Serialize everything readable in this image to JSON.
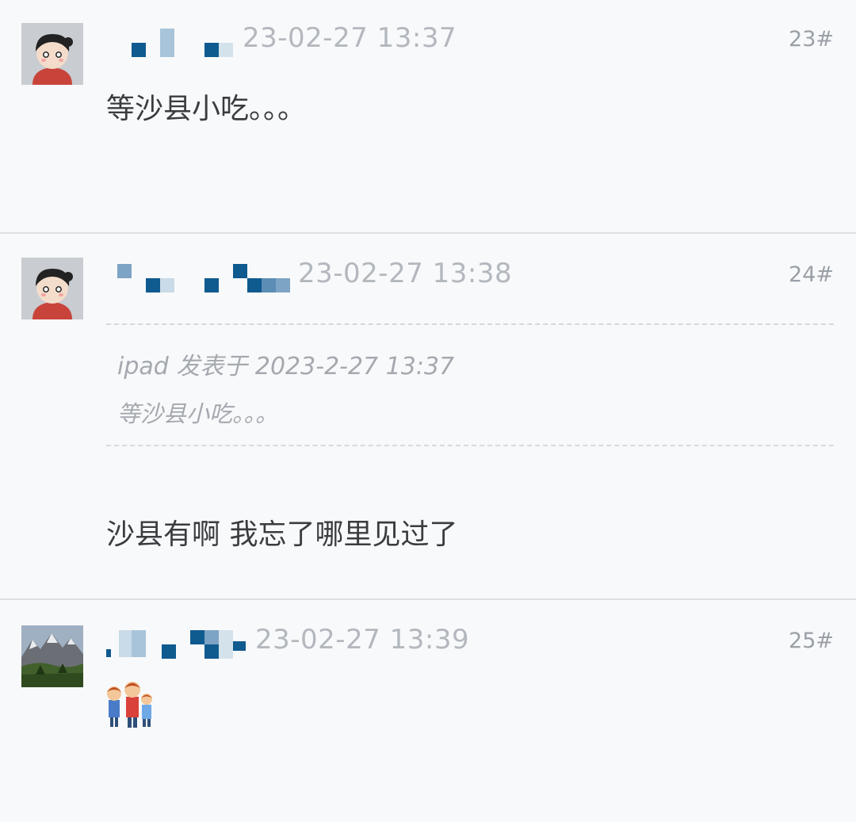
{
  "posts": [
    {
      "avatar": "girl-avatar-icon",
      "timestamp": "23-02-27 13:37",
      "floor": "23#",
      "content": "等沙县小吃。。。"
    },
    {
      "avatar": "girl-avatar-icon",
      "timestamp": "23-02-27 13:38",
      "floor": "24#",
      "quote": {
        "meta": "ipad 发表于 2023-2-27 13:37",
        "text": "等沙县小吃。。。"
      },
      "content": "沙县有啊 我忘了哪里见过了"
    },
    {
      "avatar": "mountain-landscape-avatar-icon",
      "timestamp": "23-02-27 13:39",
      "floor": "25#",
      "content_icon": "group-of-people-emoji-icon"
    }
  ],
  "colors": {
    "background": "#f8f9fa",
    "timestamp": "#b3b8be",
    "content": "#3a3c40",
    "quote": "#a4a9af",
    "pixelated_username": "#0f5a8f"
  }
}
